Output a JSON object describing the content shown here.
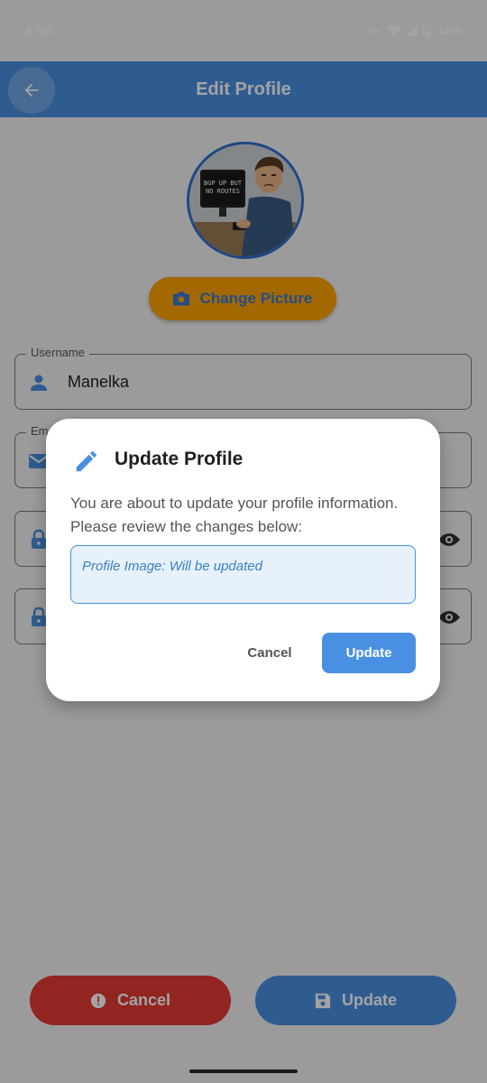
{
  "status_bar": {
    "time": "8:58",
    "battery": "44%"
  },
  "app_bar": {
    "title": "Edit Profile",
    "back_icon": "arrow-back-icon"
  },
  "avatar": {
    "screen_text_line1": "BGP UP BUT",
    "screen_text_line2": "NO ROUTES"
  },
  "change_picture": {
    "label": "Change Picture",
    "icon": "camera-icon"
  },
  "fields": {
    "username": {
      "label": "Username",
      "value": "Manelka",
      "icon": "person-icon"
    },
    "email": {
      "label": "Em",
      "icon": "mail-icon"
    },
    "password": {
      "icon": "lock-icon",
      "toggle_icon": "eye-icon"
    },
    "confirm_password": {
      "icon": "lock-icon",
      "toggle_icon": "eye-icon"
    }
  },
  "bottom_buttons": {
    "cancel": "Cancel",
    "update": "Update"
  },
  "dialog": {
    "title": "Update Profile",
    "message": "You are about to update your profile information. Please review the changes below:",
    "change_summary": "Profile Image: Will be updated",
    "cancel_label": "Cancel",
    "update_label": "Update"
  },
  "colors": {
    "primary": "#4a90e2",
    "accent": "#ffa500",
    "danger": "#e53935"
  }
}
